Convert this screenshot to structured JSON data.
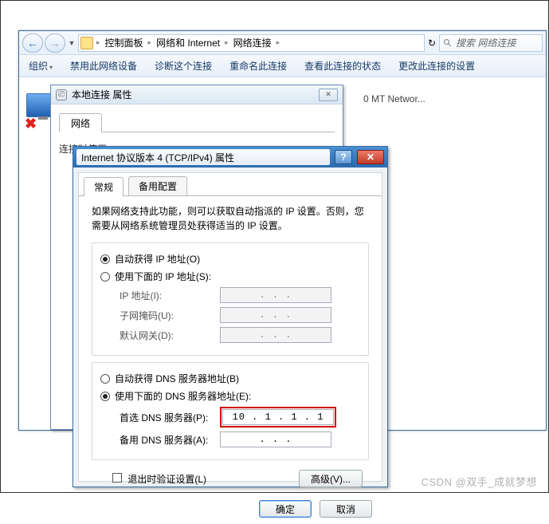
{
  "explorer": {
    "breadcrumb": [
      "控制面板",
      "网络和 Internet",
      "网络连接"
    ],
    "search_placeholder": "搜索 网络连接",
    "toolbar": {
      "org": "组织",
      "disable": "禁用此网络设备",
      "diag": "诊断这个连接",
      "rename": "重命名此连接",
      "status": "查看此连接的状态",
      "change": "更改此连接的设置"
    },
    "adapter2": "0 MT Networ..."
  },
  "dlg1": {
    "title": "本地连接 属性",
    "tab": "网络",
    "partial": "连接时使用:",
    "close": "✕"
  },
  "dlg2": {
    "title": "Internet 协议版本 4 (TCP/IPv4) 属性",
    "tabs": {
      "general": "常规",
      "alt": "备用配置"
    },
    "desc": "如果网络支持此功能，则可以获取自动指派的 IP 设置。否则，您需要从网络系统管理员处获得适当的 IP 设置。",
    "ip": {
      "auto": "自动获得 IP 地址(O)",
      "manual": "使用下面的 IP 地址(S):",
      "addr_lbl": "IP 地址(I):",
      "mask_lbl": "子网掩码(U):",
      "gw_lbl": "默认网关(D):",
      "addr_val": " .   .   . ",
      "mask_val": " .   .   . ",
      "gw_val": " .   .   . "
    },
    "dns": {
      "auto": "自动获得 DNS 服务器地址(B)",
      "manual": "使用下面的 DNS 服务器地址(E):",
      "pref_lbl": "首选 DNS 服务器(P):",
      "alt_lbl": "备用 DNS 服务器(A):",
      "pref_val": "10 .  1 .  1 .  1",
      "alt_val": "  .   .   . "
    },
    "validate": "退出时验证设置(L)",
    "advanced": "高级(V)...",
    "ok": "确定",
    "cancel": "取消"
  },
  "watermark": "CSDN @双手_成就梦想"
}
